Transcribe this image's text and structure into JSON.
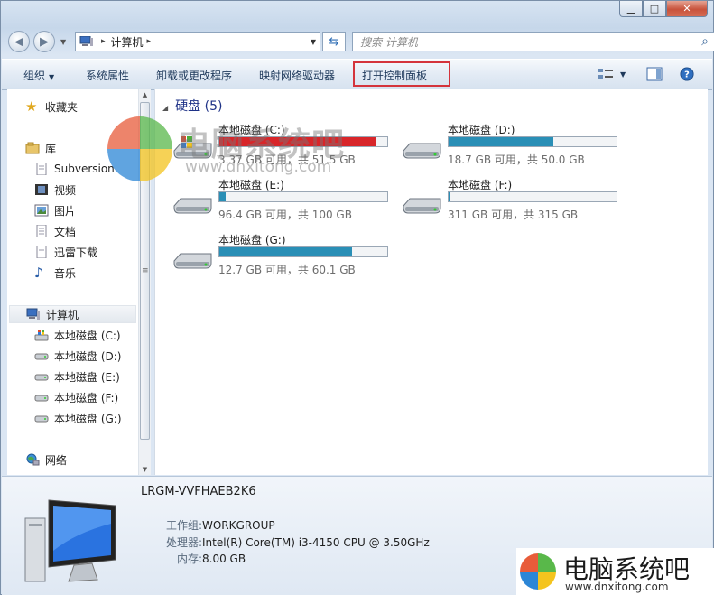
{
  "window": {
    "minimize": "▁",
    "maximize": "□",
    "close": "✕"
  },
  "nav": {
    "back_icon": "arrow-left-icon",
    "forward_icon": "arrow-right-icon"
  },
  "address": {
    "path": "计算机",
    "sep": "▸"
  },
  "search": {
    "placeholder": "搜索 计算机"
  },
  "toolbar": {
    "organize": "组织",
    "system_props": "系统属性",
    "uninstall": "卸载或更改程序",
    "map_drive": "映射网络驱动器",
    "control_panel": "打开控制面板"
  },
  "highlight_color": "#d4343c",
  "sidebar": {
    "favorites": "收藏夹",
    "library": "库",
    "lib_items": [
      "Subversion",
      "视频",
      "图片",
      "文档",
      "迅雷下载",
      "音乐"
    ],
    "computer": "计算机",
    "drives": [
      "本地磁盘 (C:)",
      "本地磁盘 (D:)",
      "本地磁盘 (E:)",
      "本地磁盘 (F:)",
      "本地磁盘 (G:)"
    ],
    "network": "网络"
  },
  "content": {
    "group_title": "硬盘 (5)",
    "drives": [
      {
        "name": "本地磁盘 (C:)",
        "info": "3.37 GB 可用，共 51.5 GB",
        "used_fraction": 0.935,
        "color": "#d8262a"
      },
      {
        "name": "本地磁盘 (D:)",
        "info": "18.7 GB 可用，共 50.0 GB",
        "used_fraction": 0.626,
        "color": "#2a8fb6"
      },
      {
        "name": "本地磁盘 (E:)",
        "info": "96.4 GB 可用，共 100 GB",
        "used_fraction": 0.036,
        "color": "#2a8fb6"
      },
      {
        "name": "本地磁盘 (F:)",
        "info": "311 GB 可用，共 315 GB",
        "used_fraction": 0.013,
        "color": "#2a8fb6"
      },
      {
        "name": "本地磁盘 (G:)",
        "info": "12.7 GB 可用，共 60.1 GB",
        "used_fraction": 0.789,
        "color": "#2a8fb6"
      }
    ]
  },
  "details": {
    "pc_name": "LRGM-VVFHAEB2K6",
    "workgroup_label": "工作组:",
    "workgroup": "WORKGROUP",
    "cpu_label": "处理器:",
    "cpu": "Intel(R) Core(TM) i3-4150 CPU @ 3.50GHz",
    "ram_label": "内存:",
    "ram": "8.00 GB"
  },
  "watermark": {
    "title": "电脑系统吧",
    "url": "www.dnxitong.com"
  }
}
